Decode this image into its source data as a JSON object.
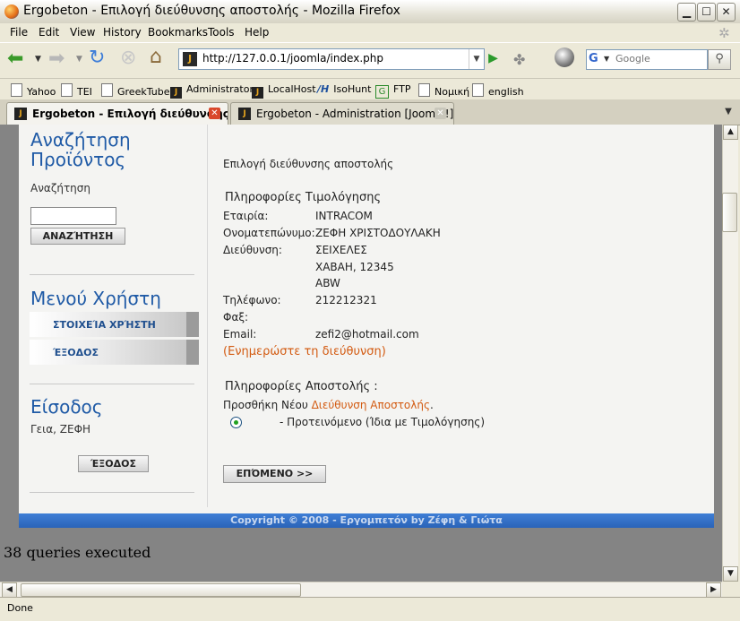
{
  "window": {
    "title": "Ergobeton - Επιλογή διεύθυνσης αποστολής - Mozilla Firefox"
  },
  "menubar": [
    "File",
    "Edit",
    "View",
    "History",
    "Bookmarks",
    "Tools",
    "Help"
  ],
  "navbar": {
    "url": "http://127.0.0.1/joomla/index.php",
    "search_placeholder": "Google"
  },
  "bookmarks": [
    "Yahoo",
    "TEI",
    "GreekTube",
    "Administrator",
    "LocalHost",
    "IsoHunt",
    "FTP",
    "Νομική",
    "english"
  ],
  "tabs": [
    {
      "label": "Ergobeton - Επιλογή διεύθυνσης ...",
      "active": true
    },
    {
      "label": "Ergobeton - Administration [Joomla!]",
      "active": false
    }
  ],
  "sidebar": {
    "search_title_1": "Αναζήτηση",
    "search_title_2": "Προϊόντος",
    "search_label": "Αναζήτηση",
    "search_button": "ΑΝΑΖΉΤΗΣΗ",
    "user_menu_title": "Μενού Χρήστη",
    "user_menu_items": [
      "ΣΤΟΙΧΕΊΑ ΧΡΉΣΤΗ",
      "ΈΞΟΔΟΣ"
    ],
    "login_title": "Είσοδος",
    "greeting": "Γεια, ΖΕΦΗ",
    "logout_button": "ΈΞΟΔΟΣ"
  },
  "main": {
    "heading": "Επιλογή διεύθυνσης αποστολής",
    "billing_title": "Πληροφορίες Τιμολόγησης",
    "billing": {
      "company_label": "Εταιρία:",
      "company": "INTRACOM",
      "name_label": "Ονοματεπώνυμο:",
      "name": "ΖΕΦΗ ΧΡΙΣΤΟΔΟΥΛΑΚΗ",
      "address_label": "Διεύθυνση:",
      "address_1": "ΣΕΙΧΕΛΕΣ",
      "address_2": "ΧΑΒΑΗ, 12345",
      "address_3": "ABW",
      "phone_label": "Τηλέφωνο:",
      "phone": "212212321",
      "fax_label": "Φαξ:",
      "email_label": "Email:",
      "email": "zefi2@hotmail.com",
      "update_link": "(Ενημερώστε τη διεύθυνση)"
    },
    "shipping_title": "Πληροφορίες Αποστολής :",
    "add_new_prefix": "Προσθήκη Νέου ",
    "add_new_link": "Διεύθυνση Αποστολής",
    "add_new_suffix": ".",
    "default_option": "- Προτεινόμενο (Ίδια με Τιμολόγησης)",
    "next_button": "ΕΠΌΜΕΝΟ >>"
  },
  "footer": {
    "copyright": "Copyright © 2008 - Εργομπετόν by Ζέφη & Γιώτα"
  },
  "queries_text": "38 queries executed",
  "status": "Done"
}
